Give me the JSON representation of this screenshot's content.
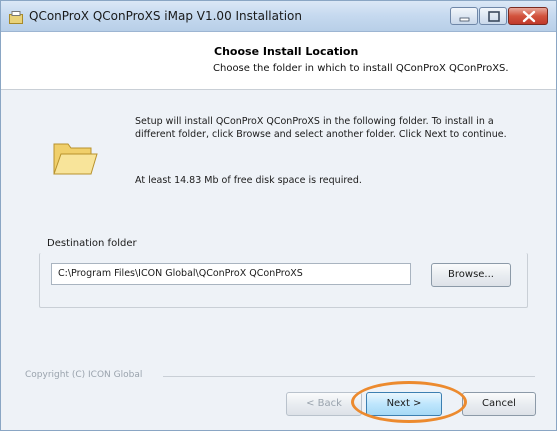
{
  "window": {
    "title": "QConProX QConProXS iMap V1.00 Installation",
    "icons": {
      "app": "installer-icon",
      "minimize": "minimize-icon",
      "maximize": "maximize-icon",
      "close": "close-icon"
    }
  },
  "header": {
    "title": "Choose Install Location",
    "subtitle": "Choose the folder in which to install QConProX QConProXS."
  },
  "body": {
    "folder_icon": "folder-icon",
    "description": "Setup will install QConProX QConProXS in the following folder. To install in a different folder, click Browse and select another folder. Click Next to continue.",
    "space_required": "At least 14.83 Mb of free disk space is required.",
    "destination": {
      "label": "Destination folder",
      "path_value": "C:\\Program Files\\ICON Global\\QConProX QConProXS",
      "browse_label": "Browse..."
    }
  },
  "footer": {
    "copyright": "Copyright (C) ICON Global",
    "back_label": "< Back",
    "next_label": "Next >",
    "cancel_label": "Cancel"
  },
  "colors": {
    "highlight": "#ec8a2e",
    "close_button": "#c0392b",
    "folder": "#f3d97a"
  }
}
